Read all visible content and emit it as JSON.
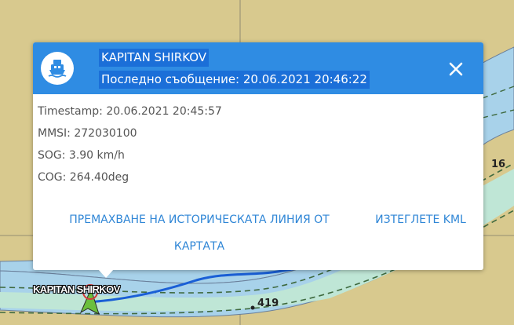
{
  "popup": {
    "vessel_name": "KAPITAN SHIRKOV",
    "last_message": "Последно съобщение: 20.06.2021 20:46:22",
    "timestamp": "Timestamp: 20.06.2021 20:45:57",
    "mmsi": "MMSI: 272030100",
    "sog": "SOG: 3.90 km/h",
    "cog": "COG: 264.40deg",
    "remove_history_action": "ПРЕМАХВАНЕ НА ИСТОРИЧЕСКАТА ЛИНИЯ ОТ КАРТАТА",
    "download_kml_action": "ИЗТЕГЛЕТЕ KML",
    "header_color": "#2f8ce3",
    "link_color": "#2f86d6"
  },
  "map": {
    "vessel_label": "KAPITAN SHIRKOV",
    "depth_label_right": "16",
    "depth_label_bottom": "419",
    "land_color": "#d8c98e",
    "water_color": "#a8d2ea",
    "channel_color": "#bfe6d6",
    "track_color": "#1a5fd6"
  }
}
